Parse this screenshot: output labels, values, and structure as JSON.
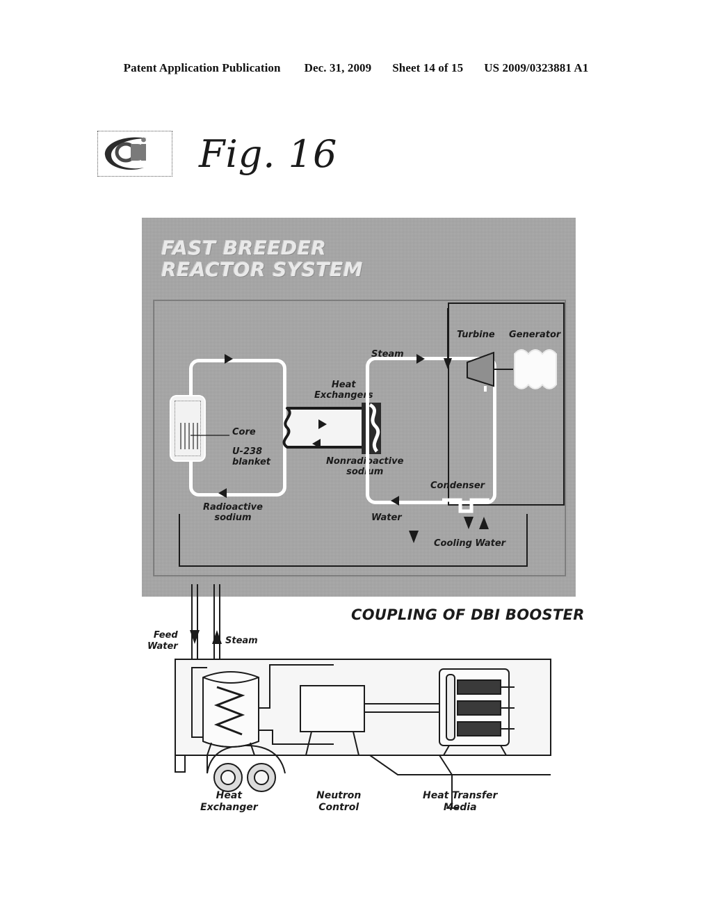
{
  "header": {
    "publication": "Patent Application Publication",
    "date": "Dec. 31, 2009",
    "sheet": "Sheet 14 of 15",
    "doc_number": "US 2009/0323881 A1"
  },
  "figure": {
    "label": "Fig. 16",
    "logo_text": "dbi"
  },
  "panel": {
    "title_line1": "FAST BREEDER",
    "title_line2": "REACTOR SYSTEM",
    "labels": {
      "core": "Core",
      "blanket_line1": "U-238",
      "blanket_line2": "blanket",
      "radioactive_line1": "Radioactive",
      "radioactive_line2": "sodium",
      "heat_exchangers_line1": "Heat",
      "heat_exchangers_line2": "Exchangers",
      "nonradioactive_line1": "Nonradioactive",
      "nonradioactive_line2": "sodium",
      "steam": "Steam",
      "turbine": "Turbine",
      "generator": "Generator",
      "condenser": "Condenser",
      "water": "Water",
      "cooling_water": "Cooling Water"
    }
  },
  "coupling": {
    "caption": "COUPLING OF DBI BOOSTER",
    "feed_water_line1": "Feed",
    "feed_water_line2": "Water",
    "steam": "Steam",
    "heat_exchanger_line1": "Heat",
    "heat_exchanger_line2": "Exchanger",
    "neutron_control_line1": "Neutron",
    "neutron_control_line2": "Control",
    "heat_transfer_line1": "Heat Transfer",
    "heat_transfer_line2": "Media"
  },
  "colors": {
    "panel_gray": "#a6a6a6",
    "ink": "#1b1b1b",
    "pipe_white": "#ffffff",
    "paper": "#ffffff"
  }
}
